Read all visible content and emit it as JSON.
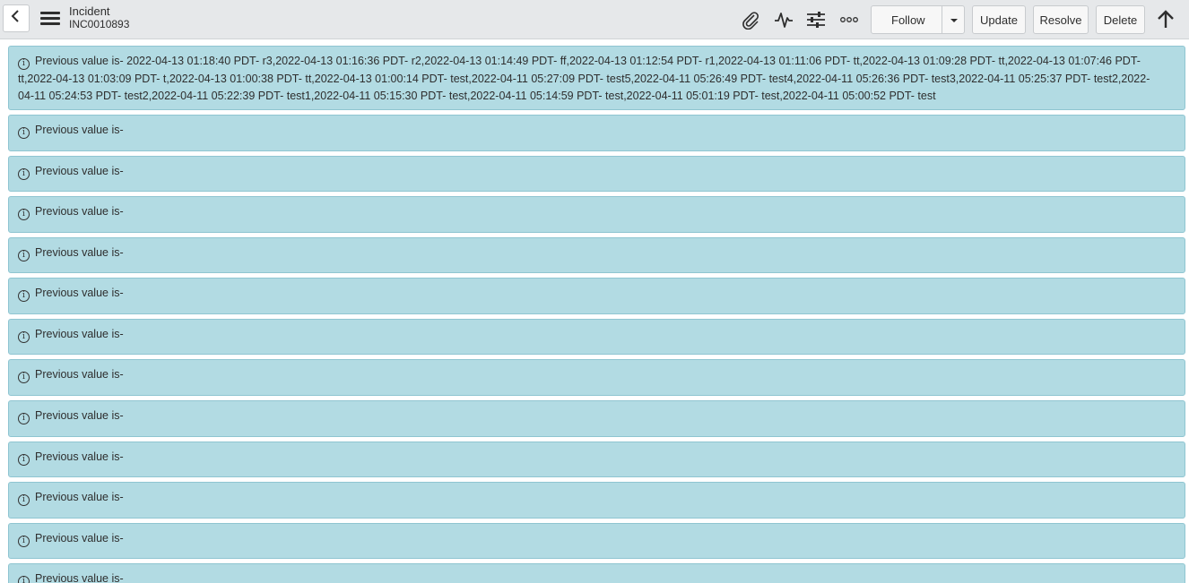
{
  "header": {
    "record_type": "Incident",
    "record_number": "INC0010893",
    "buttons": {
      "follow": "Follow",
      "update": "Update",
      "resolve": "Resolve",
      "delete": "Delete"
    },
    "icons": [
      "back-icon",
      "menu-icon",
      "paperclip-icon",
      "activity-icon",
      "settings-sliders-icon",
      "more-icon",
      "caret-down-icon",
      "arrow-up-icon"
    ]
  },
  "messages": [
    "Previous value is- 2022-04-13 01:18:40 PDT- r3,2022-04-13 01:16:36 PDT- r2,2022-04-13 01:14:49 PDT- ff,2022-04-13 01:12:54 PDT- r1,2022-04-13 01:11:06 PDT- tt,2022-04-13 01:09:28 PDT- tt,2022-04-13 01:07:46 PDT- tt,2022-04-13 01:03:09 PDT- t,2022-04-13 01:00:38 PDT- tt,2022-04-13 01:00:14 PDT- test,2022-04-11 05:27:09 PDT- test5,2022-04-11 05:26:49 PDT- test4,2022-04-11 05:26:36 PDT- test3,2022-04-11 05:25:37 PDT- test2,2022-04-11 05:24:53 PDT- test2,2022-04-11 05:22:39 PDT- test1,2022-04-11 05:15:30 PDT- test,2022-04-11 05:14:59 PDT- test,2022-04-11 05:01:19 PDT- test,2022-04-11 05:00:52 PDT- test",
    "Previous value is-",
    "Previous value is-",
    "Previous value is-",
    "Previous value is-",
    "Previous value is-",
    "Previous value is-",
    "Previous value is-",
    "Previous value is-",
    "Previous value is-",
    "Previous value is-",
    "Previous value is-",
    "Previous value is-"
  ],
  "colors": {
    "header_bg": "#e6e8ea",
    "message_bg": "#b2dbe3",
    "message_border": "#8fc5d1"
  }
}
